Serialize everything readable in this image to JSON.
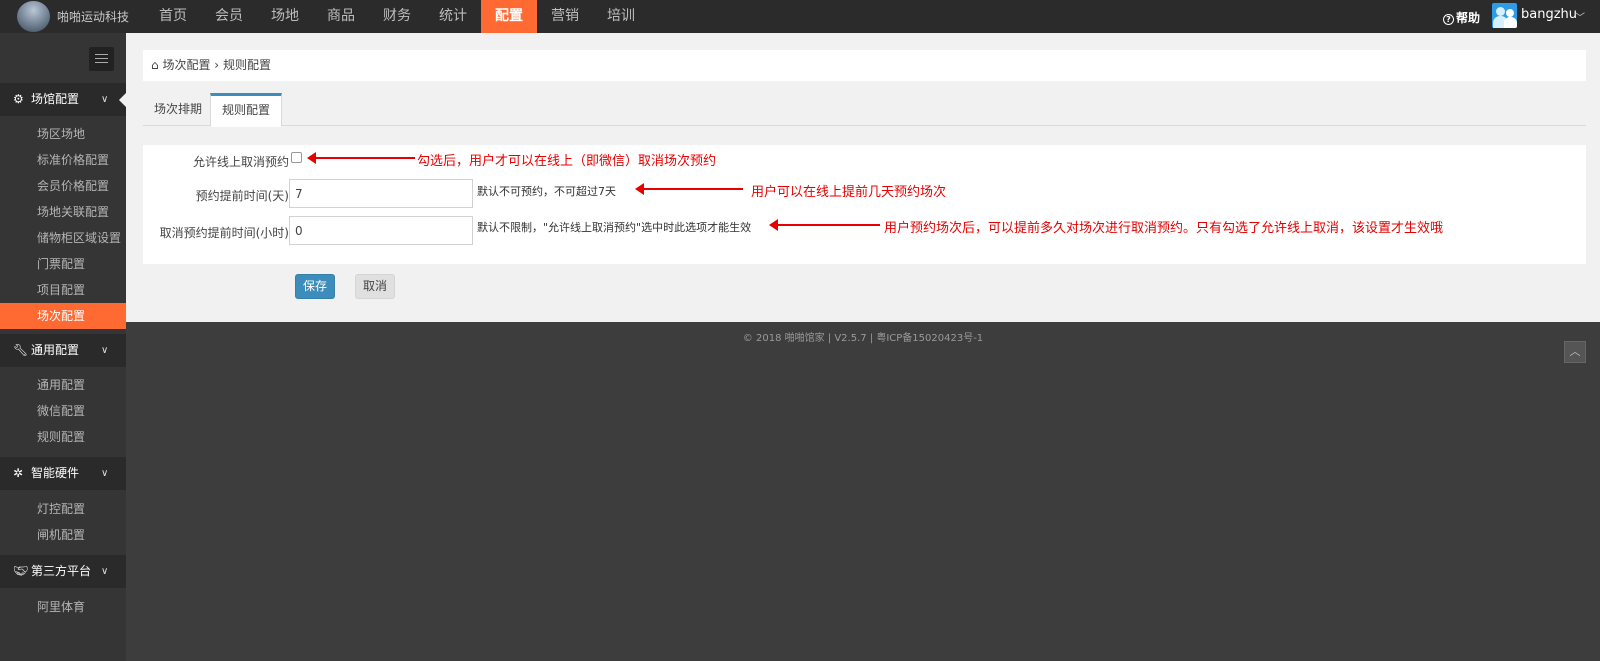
{
  "header": {
    "brand": "啪啪运动科技",
    "nav": [
      "首页",
      "会员",
      "场地",
      "商品",
      "财务",
      "统计",
      "配置",
      "营销",
      "培训"
    ],
    "active_nav": "配置",
    "help_label": "帮助",
    "username": "bangzhu"
  },
  "sidebar": {
    "sections": [
      {
        "label": "场馆配置",
        "icon": "gears-icon",
        "items": [
          "场区场地",
          "标准价格配置",
          "会员价格配置",
          "场地关联配置",
          "储物柜区域设置",
          "门票配置",
          "项目配置",
          "场次配置"
        ]
      },
      {
        "label": "通用配置",
        "icon": "wrench-icon",
        "items": [
          "通用配置",
          "微信配置",
          "规则配置"
        ]
      },
      {
        "label": "智能硬件",
        "icon": "cog-icon",
        "items": [
          "灯控配置",
          "闸机配置"
        ]
      },
      {
        "label": "第三方平台",
        "icon": "handshake-icon",
        "items": [
          "阿里体育"
        ]
      }
    ],
    "active_item": "场次配置"
  },
  "breadcrumb": {
    "parent": "场次配置",
    "separator": "›",
    "current": "规则配置"
  },
  "tabs": [
    "场次排期",
    "规则配置"
  ],
  "active_tab": "规则配置",
  "form": {
    "allow_cancel": {
      "label": "允许线上取消预约",
      "checked": false
    },
    "advance_days": {
      "label": "预约提前时间(天)",
      "value": "7",
      "hint": "默认不可预约，不可超过7天"
    },
    "cancel_hours": {
      "label": "取消预约提前时间(小时)",
      "value": "0",
      "hint": "默认不限制，\"允许线上取消预约\"选中时此选项才能生效"
    }
  },
  "annotations": {
    "a1": "勾选后，用户才可以在线上（即微信）取消场次预约",
    "a2": "用户可以在线上提前几天预约场次",
    "a3": "用户预约场次后，可以提前多久对场次进行取消预约。只有勾选了允许线上取消，该设置才生效哦",
    "color": "#e60000"
  },
  "buttons": {
    "save": "保存",
    "cancel": "取消"
  },
  "footer": "© 2018 啪啪馆家 | V2.5.7 | 粤ICP备15020423号-1",
  "colors": {
    "accent": "#ff6a33",
    "primary": "#3c8dbc",
    "topbar": "#2b2b2b",
    "sidebar": "#353535"
  }
}
